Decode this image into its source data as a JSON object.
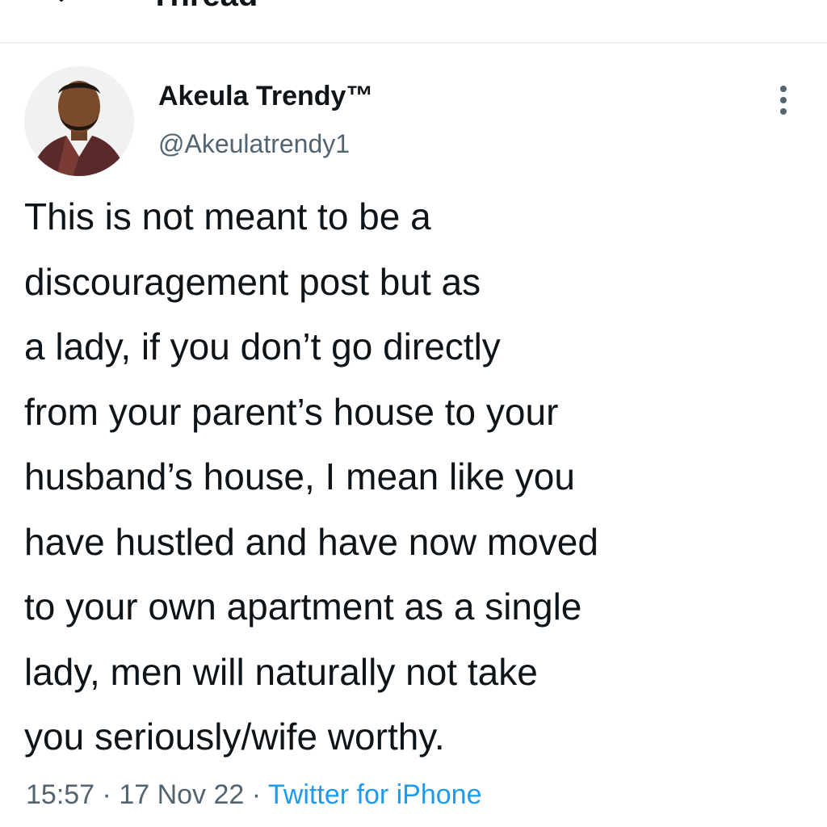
{
  "header": {
    "title": "Thread",
    "back_icon": "arrow-left-icon"
  },
  "tweet": {
    "author": {
      "display_name": "Akeula Trendy™",
      "handle": "@Akeulatrendy1"
    },
    "more_icon": "vertical-dots-icon",
    "text_lines": [
      "This is not meant to be a",
      "discouragement post but as",
      "a lady, if you don’t go directly",
      "from your parent’s house to your",
      "husband’s house, I mean like you",
      "have hustled and have now moved",
      "to your own apartment as a single",
      "lady, men will naturally not take",
      "you seriously/wife worthy."
    ],
    "meta": {
      "time": "15:57",
      "separator": " · ",
      "date": "17 Nov 22",
      "source": "Twitter for iPhone"
    }
  },
  "colors": {
    "text": "#0f1419",
    "secondary_text": "#536471",
    "link": "#1d9bf0",
    "divider": "#eff3f4"
  }
}
